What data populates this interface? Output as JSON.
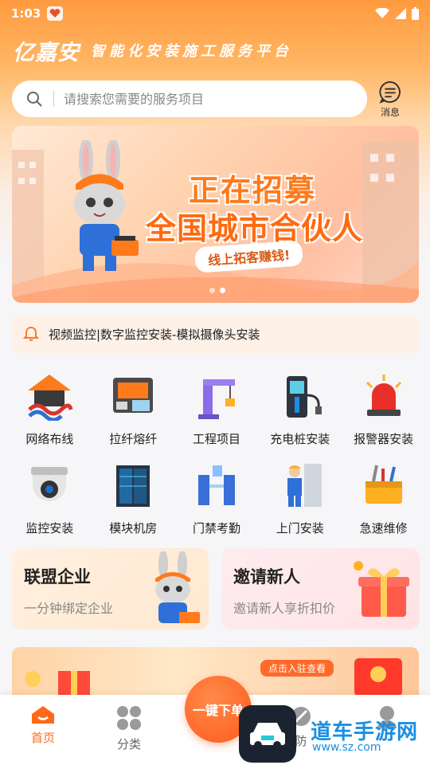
{
  "status_bar": {
    "time": "1:03"
  },
  "header": {
    "logo": "亿嘉安",
    "slogan": "智能化安装施工服务平台",
    "search_placeholder": "请搜索您需要的服务项目",
    "message_label": "消息"
  },
  "banner": {
    "title_line1": "正在招募",
    "title_line2": "全国城市合伙人",
    "subtitle": "线上拓客赚钱!",
    "slide_count": 2,
    "active_slide": 1
  },
  "notice": {
    "text": "视频监控|数字监控安装-模拟摄像头安装"
  },
  "services": [
    {
      "label": "网络布线",
      "icon": "network-cabling-icon"
    },
    {
      "label": "拉纤熔纤",
      "icon": "fiber-splicer-icon"
    },
    {
      "label": "工程项目",
      "icon": "crane-icon"
    },
    {
      "label": "充电桩安装",
      "icon": "charging-pile-icon"
    },
    {
      "label": "报警器安装",
      "icon": "alarm-light-icon"
    },
    {
      "label": "监控安装",
      "icon": "dome-camera-icon"
    },
    {
      "label": "模块机房",
      "icon": "server-rack-icon"
    },
    {
      "label": "门禁考勤",
      "icon": "access-gate-icon"
    },
    {
      "label": "上门安装",
      "icon": "worker-icon"
    },
    {
      "label": "急速维修",
      "icon": "toolbox-icon"
    }
  ],
  "promos": [
    {
      "title": "联盟企业",
      "subtitle": "一分钟绑定企业"
    },
    {
      "title": "邀请新人",
      "subtitle": "邀请新人享折扣价"
    }
  ],
  "strip": {
    "tag": "点击入驻查看"
  },
  "bottom_nav": {
    "items": [
      {
        "label": "首页",
        "icon": "home-icon"
      },
      {
        "label": "分类",
        "icon": "category-icon"
      },
      {
        "label": "防",
        "icon": "shield-icon"
      },
      {
        "label": "",
        "icon": "user-icon"
      }
    ],
    "order_button": "一键下单"
  },
  "watermark": {
    "text": "道车手游网",
    "url": "www.sz.com"
  },
  "colors": {
    "accent": "#ff6a1a",
    "header_gradient_top": "#ff9a3e"
  }
}
